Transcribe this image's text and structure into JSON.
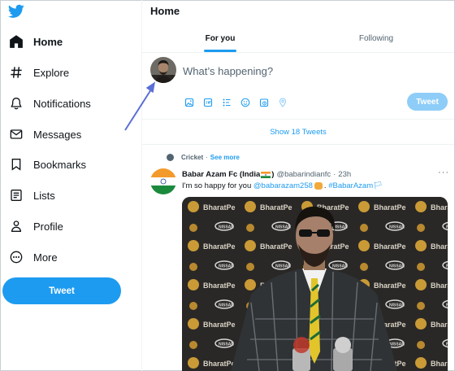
{
  "sidebar": {
    "items": [
      {
        "label": "Home",
        "icon": "home-icon",
        "active": true
      },
      {
        "label": "Explore",
        "icon": "hashtag-icon"
      },
      {
        "label": "Notifications",
        "icon": "bell-icon"
      },
      {
        "label": "Messages",
        "icon": "envelope-icon"
      },
      {
        "label": "Bookmarks",
        "icon": "bookmark-icon"
      },
      {
        "label": "Lists",
        "icon": "list-icon"
      },
      {
        "label": "Profile",
        "icon": "person-icon"
      },
      {
        "label": "More",
        "icon": "more-circle-icon"
      }
    ],
    "tweet_button": "Tweet"
  },
  "header": {
    "title": "Home",
    "tabs": [
      {
        "label": "For you",
        "selected": true
      },
      {
        "label": "Following",
        "selected": false
      }
    ]
  },
  "composer": {
    "placeholder": "What’s happening?",
    "post_button": "Tweet",
    "tool_icons": [
      "image-icon",
      "gif-icon",
      "poll-icon",
      "emoji-icon",
      "schedule-icon",
      "location-icon"
    ]
  },
  "timeline": {
    "show_new": "Show 18 Tweets",
    "tweet": {
      "context_topic": "Cricket",
      "context_separator": "·",
      "context_link": "See more",
      "display_name": "Babar Azam Fc (India",
      "display_name_end": ")",
      "handle": "@babarindianfc",
      "dot": "·",
      "time": "23h",
      "text_prefix": "I'm so happy for you ",
      "mention": "@babarazam258",
      "hashtag": "#BabarAzam🏳",
      "more": "···"
    }
  },
  "colors": {
    "accent": "#1d9bf0",
    "text": "#0f1419",
    "muted": "#536471",
    "annotation_arrow": "#5b6fd6"
  }
}
